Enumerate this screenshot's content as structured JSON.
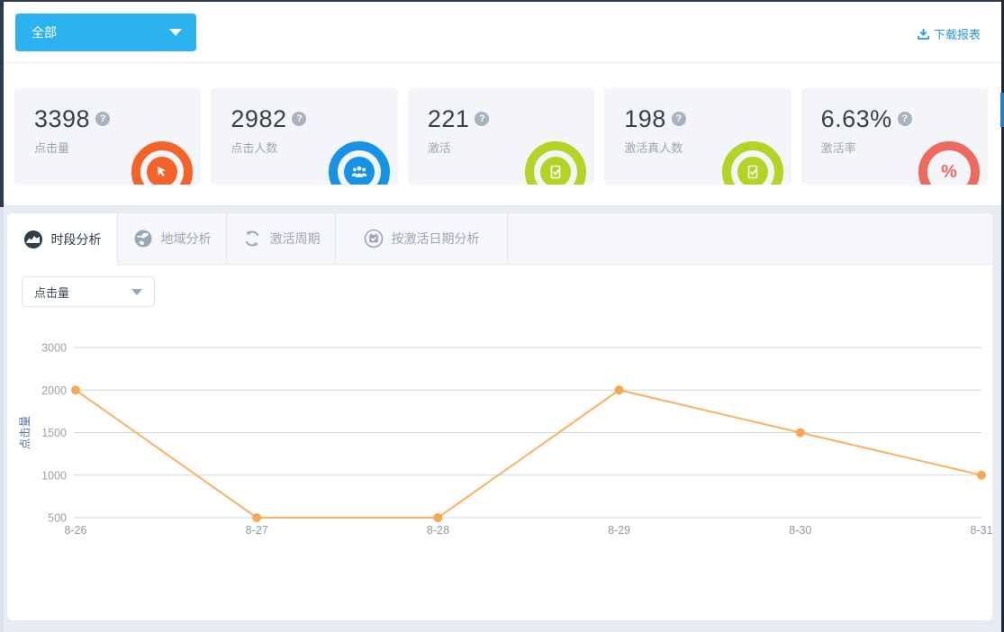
{
  "toolbar": {
    "filter_value": "全部",
    "download_label": "下载报表"
  },
  "stats_cards": [
    {
      "value": "3398",
      "label": "点击量",
      "icon": "cursor-click-icon",
      "color": "#f4632a"
    },
    {
      "value": "2982",
      "label": "点击人数",
      "icon": "people-icon",
      "color": "#1593e8"
    },
    {
      "value": "221",
      "label": "激活",
      "icon": "device-check-icon",
      "color": "#b3d424"
    },
    {
      "value": "198",
      "label": "激活真人数",
      "icon": "device-check-icon",
      "color": "#b3d424"
    },
    {
      "value": "6.63%",
      "label": "激活率",
      "icon": "percent-icon",
      "color": "#ee6a5e",
      "icon_text": "%"
    }
  ],
  "tabs": [
    {
      "label": "时段分析",
      "icon": "area-chart-icon",
      "active": true
    },
    {
      "label": "地域分析",
      "icon": "globe-icon",
      "active": false
    },
    {
      "label": "激活周期",
      "icon": "refresh-icon",
      "active": false
    },
    {
      "label": "按激活日期分析",
      "icon": "calendar-check-icon",
      "active": false
    }
  ],
  "metric_select": {
    "value": "点击量"
  },
  "chart_data": {
    "type": "line",
    "x": [
      "8-26",
      "8-27",
      "8-28",
      "8-29",
      "8-30",
      "8-31"
    ],
    "series": [
      {
        "name": "点击量",
        "values": [
          2000,
          500,
          500,
          2000,
          1500,
          1000
        ]
      }
    ],
    "ylabel": "点击量",
    "yticks": [
      500,
      1000,
      1500,
      2000,
      3000
    ],
    "grid": true,
    "legend": false,
    "line_color": "#f9b163",
    "marker_color": "#f8a750",
    "grid_color": "#cdd9e1",
    "tick_color": "#9aa1a9",
    "xtick_color": "#8d99a4",
    "ylabel_color": "#5577a7"
  }
}
